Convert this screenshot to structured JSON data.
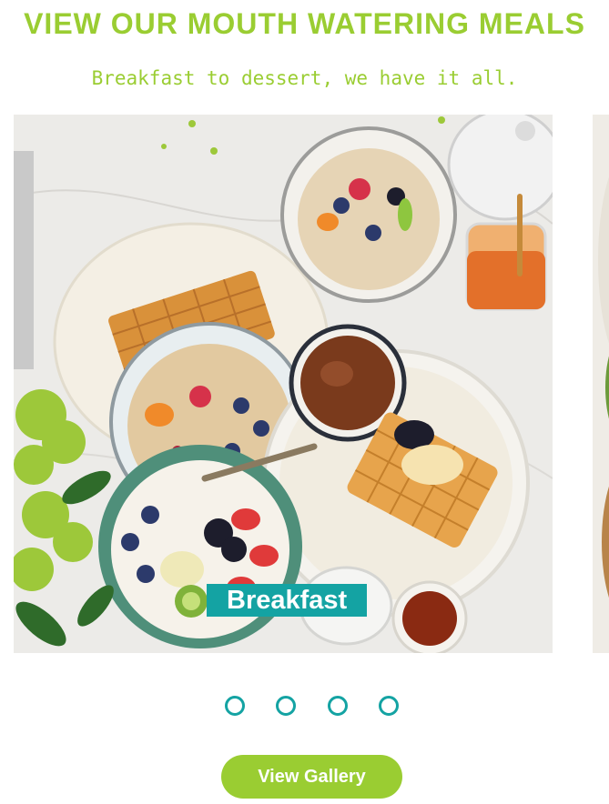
{
  "section": {
    "title": "VIEW OUR MOUTH WATERING MEALS",
    "subtitle": "Breakfast to dessert, we have it all."
  },
  "carousel": {
    "active_index": 0,
    "slides": [
      {
        "caption": "Breakfast"
      }
    ],
    "dot_count": 4
  },
  "cta": {
    "label": "View Gallery"
  },
  "colors": {
    "accent_green": "#9acd32",
    "accent_teal": "#14a3a3",
    "background": "#ffffff"
  }
}
